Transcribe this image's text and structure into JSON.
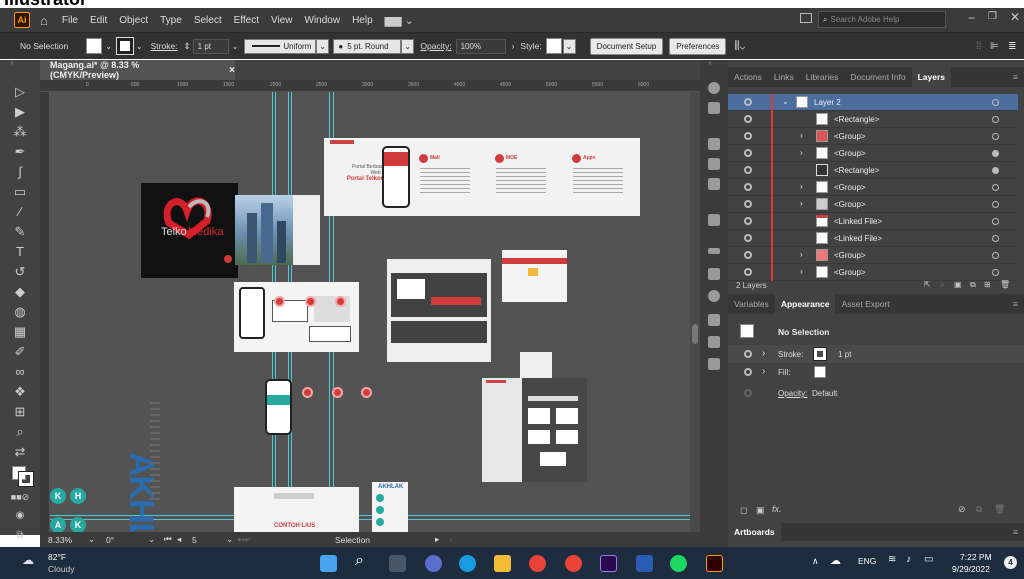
{
  "caption": "Illustrator",
  "menubar": {
    "logo": "Ai",
    "items": [
      "File",
      "Edit",
      "Object",
      "Type",
      "Select",
      "Effect",
      "View",
      "Window",
      "Help"
    ],
    "search_placeholder": "Search Adobe Help"
  },
  "control": {
    "selection": "No Selection",
    "stroke_label": "Stroke:",
    "stroke_value": "1 pt",
    "uniform": "Uniform",
    "brush": "5 pt. Round",
    "opacity_label": "Opacity:",
    "opacity_value": "100%",
    "style_label": "Style:",
    "doc_setup": "Document Setup",
    "prefs": "Preferences"
  },
  "document": {
    "tab_title": "Magang.ai* @ 8.33 % (CMYK/Preview)",
    "close": "×",
    "ruler_ticks": [
      "0",
      "500",
      "1000",
      "1500",
      "2000",
      "2500",
      "3000",
      "3500",
      "4000",
      "4500",
      "5000",
      "5500",
      "6000"
    ]
  },
  "canvas": {
    "logo_text_a": "Telko",
    "logo_text_b": "Medika",
    "slide_title_1": "Portal Telkom",
    "sections": [
      "Mall",
      "MOE",
      "Apps"
    ],
    "akhlak_text": "AKHLAK",
    "akhlak_small": "AKHLAK",
    "bottom_label": "CONTOH LIUS",
    "teal_letters": [
      "K",
      "H",
      "A",
      "K"
    ]
  },
  "status": {
    "zoom": "8.33%",
    "angle": "0°",
    "page": "5",
    "tool": "Selection"
  },
  "layers": {
    "tabs": [
      "Actions",
      "Links",
      "Libraries",
      "Document Info",
      "Layers"
    ],
    "active_tab": "Layers",
    "rows": [
      "Layer 2",
      "<Rectangle>",
      "<Group>",
      "<Group>",
      "<Rectangle>",
      "<Group>",
      "<Group>",
      "<Linked File>",
      "<Linked File>",
      "<Group>",
      "<Group>"
    ],
    "footer": "2 Layers"
  },
  "appearance": {
    "tabs": [
      "Variables",
      "Appearance",
      "Asset Export"
    ],
    "active_tab": "Appearance",
    "no_selection": "No Selection",
    "stroke_label": "Stroke:",
    "stroke_value": "1 pt",
    "fill_label": "Fill:",
    "opacity_label": "Opacity:",
    "opacity_value": "Default",
    "fx": "fx."
  },
  "artboards": {
    "label": "Artboards"
  },
  "taskbar": {
    "temp": "82°F",
    "weather": "Cloudy",
    "lang": "ENG",
    "time": "7:22 PM",
    "date": "9/29/2022",
    "badge": "4"
  },
  "colors": {
    "accent": "#d23b3b",
    "guide": "#4fc7d4",
    "teal": "#27a9a1",
    "panel": "#424242"
  }
}
